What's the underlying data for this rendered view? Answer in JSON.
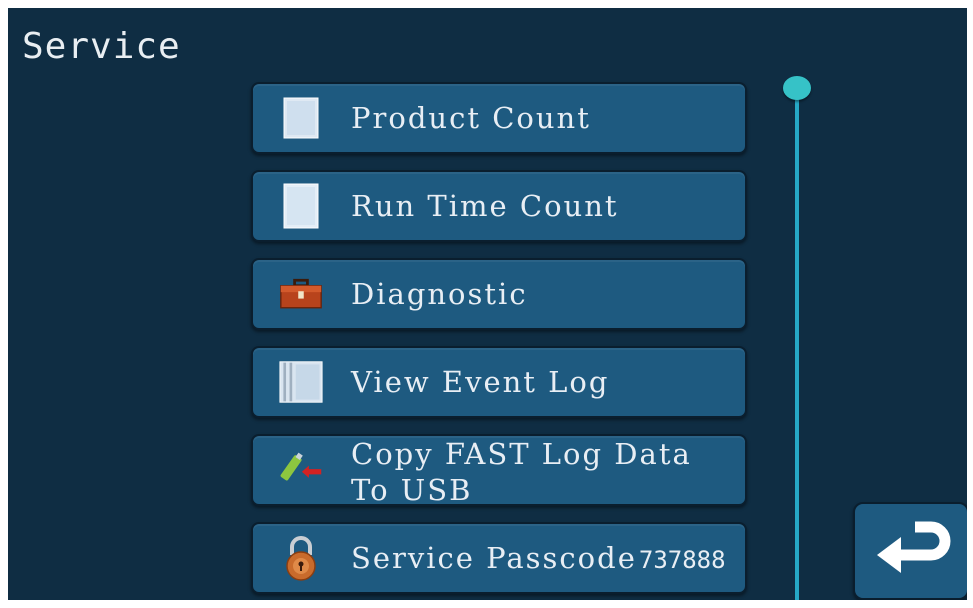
{
  "screen": {
    "title": "Service"
  },
  "menu": {
    "items": [
      {
        "label": "Product Count",
        "icon": "document-icon"
      },
      {
        "label": "Run Time Count",
        "icon": "document-icon"
      },
      {
        "label": "Diagnostic",
        "icon": "toolbox-icon"
      },
      {
        "label": "View Event Log",
        "icon": "event-log-icon"
      },
      {
        "label": "Copy FAST Log Data To USB",
        "icon": "usb-copy-icon"
      },
      {
        "label": "Service Passcode",
        "value": "737888",
        "icon": "padlock-icon"
      }
    ]
  },
  "scrollbar": {
    "position": 0
  },
  "navigation": {
    "back_icon": "return-arrow-icon"
  },
  "colors": {
    "background": "#0f2d43",
    "button": "#1e5a80",
    "button_border": "#0a1e2e",
    "text": "#e8eef4",
    "scroll_track": "#26a8c6",
    "scroll_thumb": "#36c2c7"
  }
}
